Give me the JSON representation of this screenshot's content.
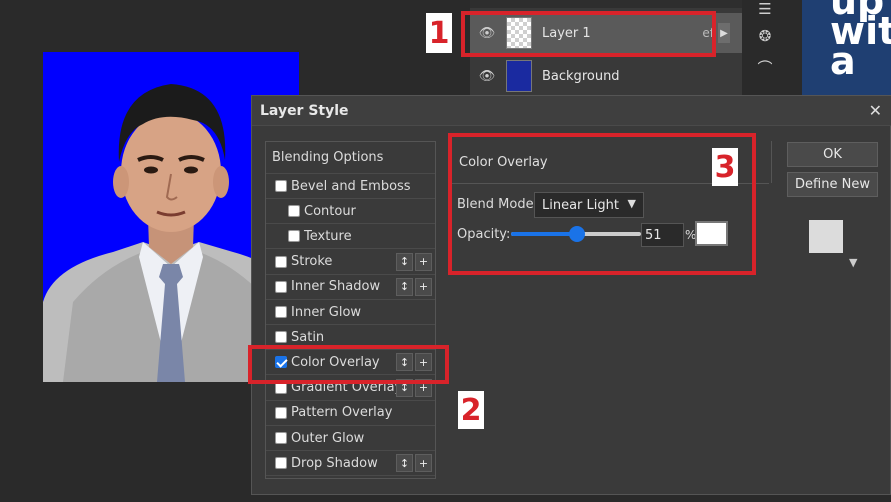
{
  "layers": {
    "items": [
      {
        "name": "Layer 1",
        "fx": "ef"
      },
      {
        "name": "Background"
      }
    ]
  },
  "ad": {
    "text": "up\nwit\na"
  },
  "dialog": {
    "title": "Layer Style",
    "close": "✕",
    "styles": [
      {
        "label": "Blending Options",
        "checked": null,
        "head": true
      },
      {
        "label": "Bevel and Emboss",
        "checked": false
      },
      {
        "label": "Contour",
        "checked": false,
        "sub": true
      },
      {
        "label": "Texture",
        "checked": false,
        "sub": true
      },
      {
        "label": "Stroke",
        "checked": false,
        "extras": true
      },
      {
        "label": "Inner Shadow",
        "checked": false,
        "extras": true
      },
      {
        "label": "Inner Glow",
        "checked": false
      },
      {
        "label": "Satin",
        "checked": false
      },
      {
        "label": "Color Overlay",
        "checked": true,
        "extras": true
      },
      {
        "label": "Gradient Overlay",
        "checked": false,
        "extras": true
      },
      {
        "label": "Pattern Overlay",
        "checked": false
      },
      {
        "label": "Outer Glow",
        "checked": false
      },
      {
        "label": "Drop Shadow",
        "checked": false,
        "extras": true
      }
    ],
    "panel": {
      "title": "Color Overlay",
      "blend_mode_label": "Blend Mode:",
      "blend_mode_value": "Linear Light",
      "opacity_label": "Opacity:",
      "opacity_value": "51",
      "opacity_unit": "%",
      "opacity_fraction": 0.51,
      "overlay_color": "#ffffff"
    },
    "buttons": {
      "ok": "OK",
      "define_new": "Define New"
    },
    "preview_arrow": "▼"
  },
  "annotations": [
    "1",
    "2",
    "3"
  ],
  "colors": {
    "annotation": "#d8232a",
    "accent": "#1a73e8",
    "photo_bg": "#0000ff"
  }
}
